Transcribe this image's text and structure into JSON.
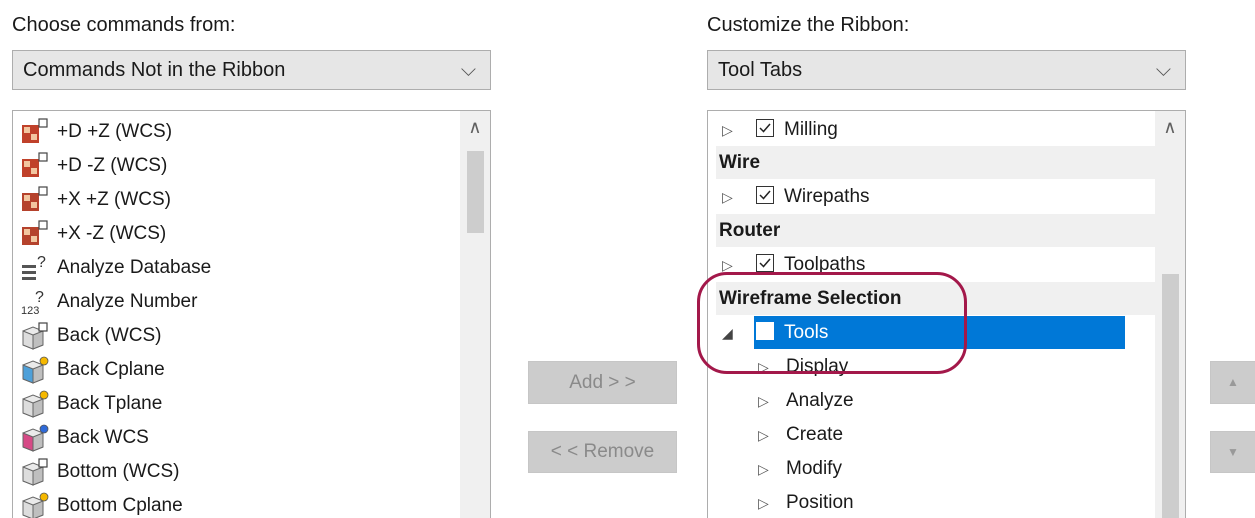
{
  "left": {
    "label": "Choose commands from:",
    "dropdown_value": "Commands Not in the Ribbon",
    "items": [
      {
        "label": "+D +Z (WCS)",
        "icon": "plane-dz-icon"
      },
      {
        "label": "+D -Z (WCS)",
        "icon": "plane-dz-neg-icon"
      },
      {
        "label": "+X +Z (WCS)",
        "icon": "plane-xz-icon"
      },
      {
        "label": "+X -Z (WCS)",
        "icon": "plane-xz-neg-icon"
      },
      {
        "label": "Analyze Database",
        "icon": "analyze-database-icon"
      },
      {
        "label": "Analyze Number",
        "icon": "analyze-number-icon"
      },
      {
        "label": "Back (WCS)",
        "icon": "back-wcs-icon"
      },
      {
        "label": "Back Cplane",
        "icon": "back-cplane-icon"
      },
      {
        "label": "Back Tplane",
        "icon": "back-tplane-icon"
      },
      {
        "label": "Back WCS",
        "icon": "back-wcs-view-icon"
      },
      {
        "label": "Bottom (WCS)",
        "icon": "bottom-wcs-icon"
      },
      {
        "label": "Bottom Cplane",
        "icon": "bottom-cplane-icon"
      }
    ]
  },
  "buttons": {
    "add": "Add > >",
    "remove": "< < Remove"
  },
  "right": {
    "label": "Customize the Ribbon:",
    "dropdown_value": "Tool Tabs",
    "tree": {
      "milling": "Milling",
      "group_wire": "Wire",
      "wirepaths": "Wirepaths",
      "group_router": "Router",
      "toolpaths": "Toolpaths",
      "group_wireframe": "Wireframe Selection",
      "tools": "Tools",
      "children": [
        "Display",
        "Analyze",
        "Create",
        "Modify",
        "Position"
      ]
    }
  },
  "colors": {
    "selection": "#0078d7",
    "callout": "#a3184a",
    "group_header_bg": "#f0f0f0"
  }
}
